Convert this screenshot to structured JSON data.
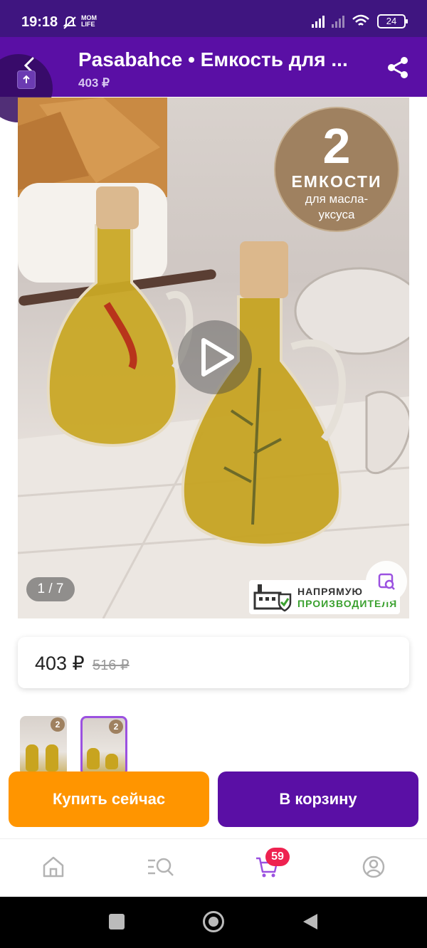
{
  "status_bar": {
    "time": "19:18",
    "carrier_logo": "MOM LIFE",
    "battery": "24"
  },
  "app_bar": {
    "title": "Pasabahce • Емкость для ...",
    "subtitle": "403 ₽"
  },
  "product_image": {
    "badge_number": "2",
    "badge_title": "ЕМКОСТИ",
    "badge_text_1": "для масла-",
    "badge_text_2": "уксуса",
    "counter": "1 / 7",
    "maker_line1": "НАПРЯМУЮ",
    "maker_line2": "ПРОИЗВОДИТЕЛЯ"
  },
  "price": {
    "current": "403 ₽",
    "old": "516 ₽"
  },
  "thumbnails": [
    {
      "badge": "2"
    },
    {
      "badge": "2"
    }
  ],
  "actions": {
    "buy_now": "Купить сейчас",
    "add_to_cart": "В корзину"
  },
  "bottom_nav": {
    "cart_count": "59"
  },
  "colors": {
    "brand_purple": "#5a0fa5",
    "status_purple": "#3f1580",
    "buy_orange": "#ff9500",
    "badge_red": "#ee2250"
  }
}
